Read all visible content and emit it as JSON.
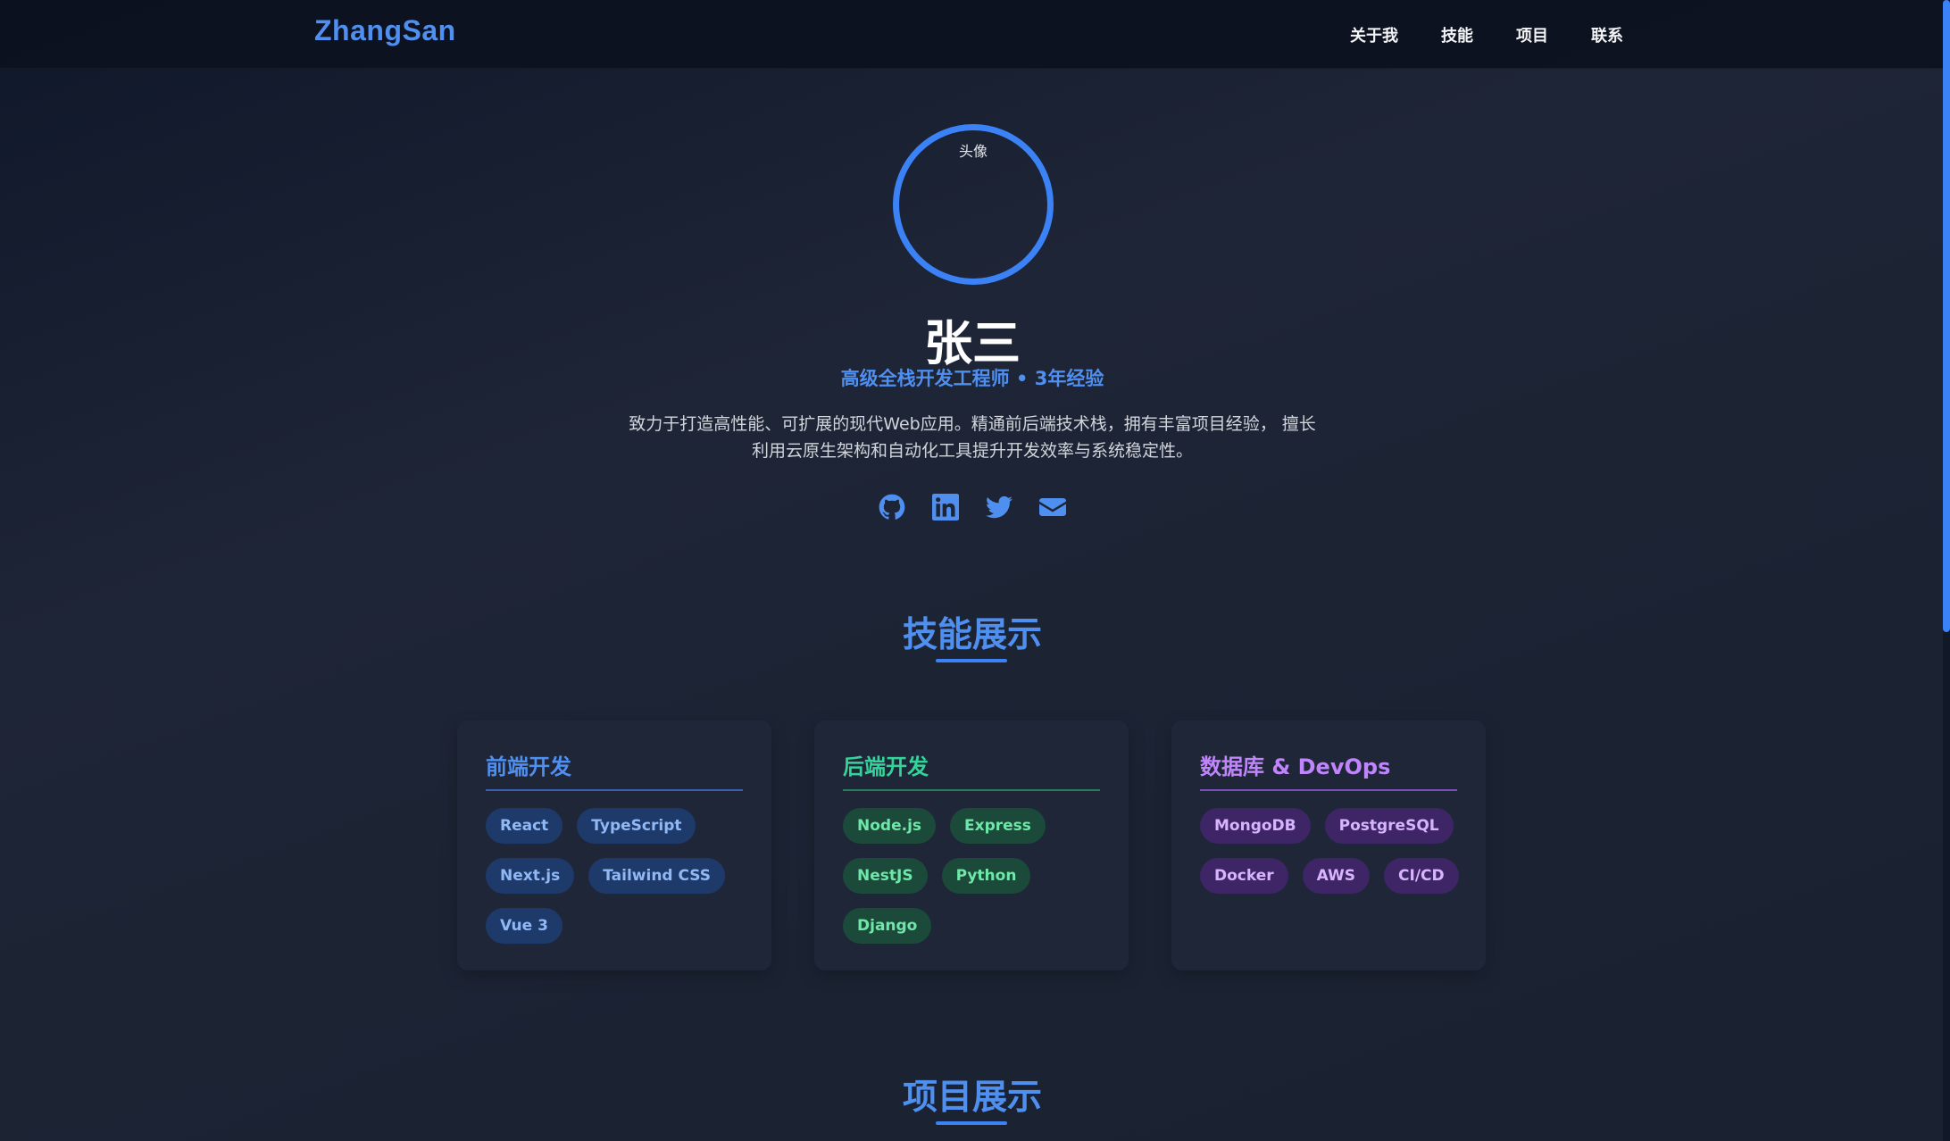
{
  "nav": {
    "logo": "ZhangSan",
    "links": [
      "关于我",
      "技能",
      "项目",
      "联系"
    ]
  },
  "hero": {
    "avatar_alt": "头像",
    "name": "张三",
    "role": "高级全栈开发工程师 • 3年经验",
    "bio": "致力于打造高性能、可扩展的现代Web应用。精通前后端技术栈，拥有丰富项目经验， 擅长利用云原生架构和自动化工具提升开发效率与系统稳定性。",
    "socials": [
      "github-icon",
      "linkedin-icon",
      "twitter-icon",
      "email-icon"
    ]
  },
  "skills": {
    "title": "技能展示",
    "cards": [
      {
        "title": "前端开发",
        "tags": [
          "React",
          "TypeScript",
          "Next.js",
          "Tailwind CSS",
          "Vue 3"
        ]
      },
      {
        "title": "后端开发",
        "tags": [
          "Node.js",
          "Express",
          "NestJS",
          "Python",
          "Django"
        ]
      },
      {
        "title": "数据库 & DevOps",
        "tags": [
          "MongoDB",
          "PostgreSQL",
          "Docker",
          "AWS",
          "CI/CD"
        ]
      }
    ]
  },
  "projects": {
    "title": "项目展示"
  },
  "colors": {
    "accent": "#3b82f6",
    "frontend": "#4f8ff0",
    "backend": "#34d399",
    "devops": "#c084fc"
  }
}
